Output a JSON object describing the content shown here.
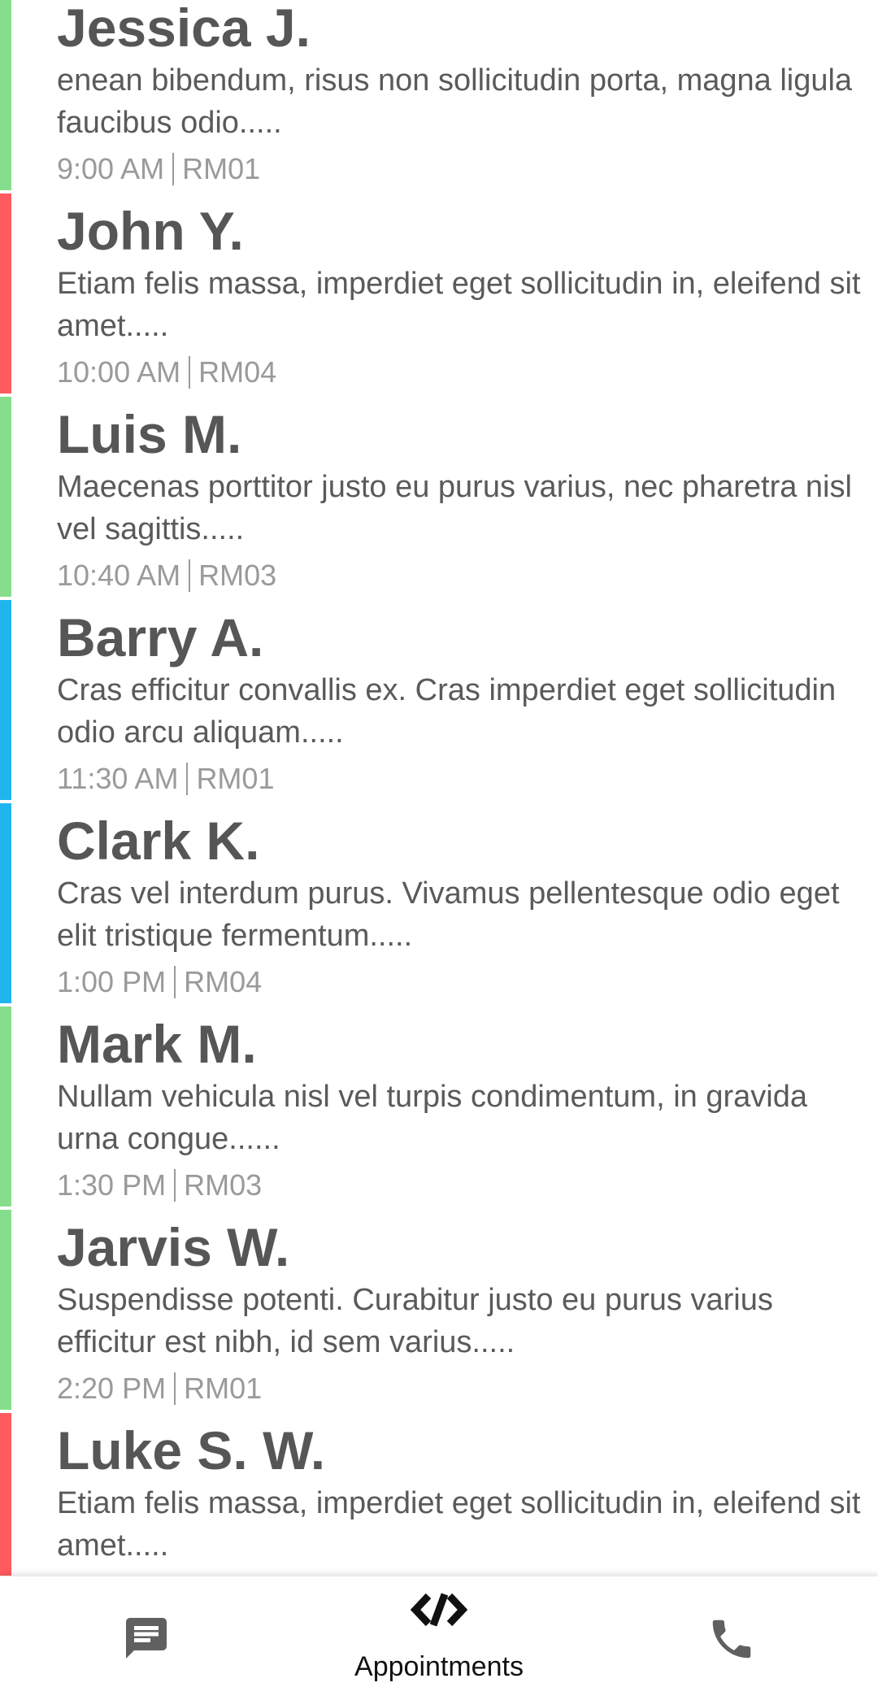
{
  "colors": {
    "green": "#86DE8C",
    "red": "#FF5A5F",
    "blue": "#1FB6F0",
    "text": "#565656",
    "muted": "#9A9A9A"
  },
  "appointments": [
    {
      "name": "Jessica J.",
      "description": "enean bibendum, risus non sollicitudin porta, magna ligula faucibus odio.....",
      "time": "9:00 AM",
      "room": "RM01",
      "color": "green"
    },
    {
      "name": "John Y.",
      "description": "Etiam felis massa, imperdiet eget sollicitudin in, eleifend sit amet.....",
      "time": "10:00 AM",
      "room": "RM04",
      "color": "red"
    },
    {
      "name": "Luis M.",
      "description": "Maecenas porttitor justo eu purus varius, nec pharetra nisl vel sagittis.....",
      "time": "10:40 AM",
      "room": "RM03",
      "color": "green"
    },
    {
      "name": "Barry A.",
      "description": "Cras efficitur convallis ex. Cras imperdiet eget sollicitudin odio arcu aliquam.....",
      "time": "11:30 AM",
      "room": "RM01",
      "color": "blue"
    },
    {
      "name": "Clark K.",
      "description": "Cras vel interdum purus. Vivamus pellentesque odio eget elit tristique fermentum.....",
      "time": "1:00 PM",
      "room": "RM04",
      "color": "blue"
    },
    {
      "name": "Mark M.",
      "description": "Nullam vehicula nisl vel turpis condimentum, in gravida urna congue......",
      "time": "1:30 PM",
      "room": "RM03",
      "color": "green"
    },
    {
      "name": "Jarvis W.",
      "description": "Suspendisse potenti. Curabitur justo eu purus varius efficitur est nibh, id sem varius.....",
      "time": "2:20 PM",
      "room": "RM01",
      "color": "green"
    },
    {
      "name": "Luke S. W.",
      "description": "Etiam felis massa, imperdiet eget sollicitudin in, eleifend sit amet.....",
      "time": "",
      "room": "",
      "color": "red"
    }
  ],
  "bottom_nav": {
    "messages_icon": "chat-bubble-icon",
    "appointments_icon": "code-slash-icon",
    "appointments_label": "Appointments",
    "calls_icon": "phone-icon",
    "icon_color": "#606060",
    "active_color": "#111111"
  }
}
